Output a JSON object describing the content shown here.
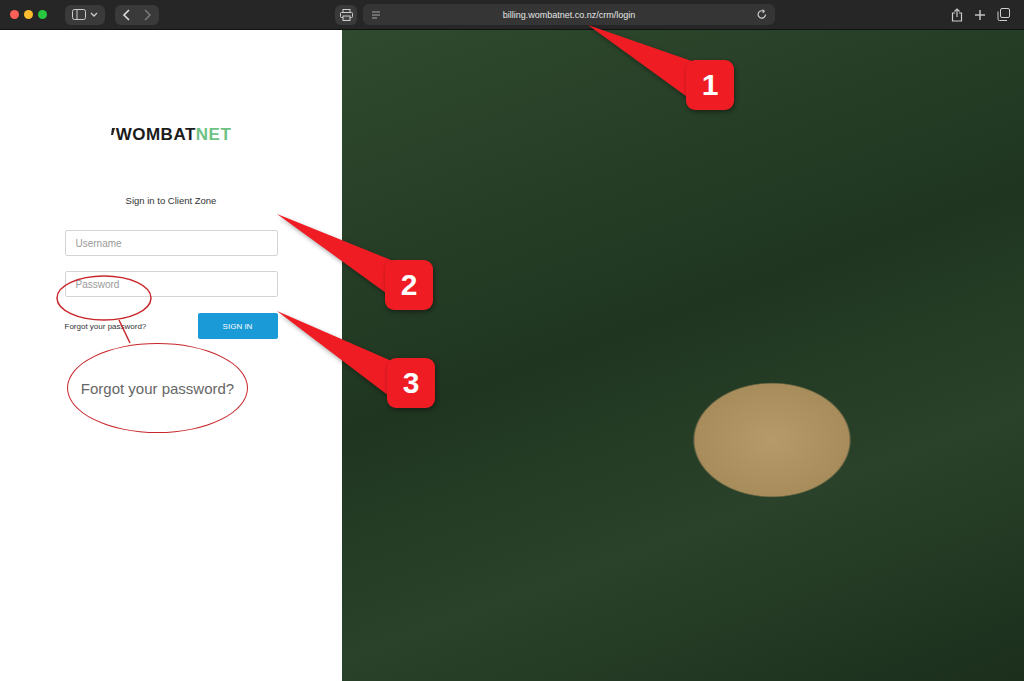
{
  "browser": {
    "url": "billing.wombatnet.co.nz/crm/login"
  },
  "login": {
    "logo": {
      "main": "WOMBAT",
      "accent": "NET"
    },
    "heading": "Sign in to Client Zone",
    "fields": [
      {
        "placeholder": "Username"
      },
      {
        "placeholder": "Password"
      }
    ],
    "forgot_link": "Forgot your password?",
    "button": "SIGN IN"
  },
  "annotations": {
    "badges": [
      {
        "label": "1"
      },
      {
        "label": "2"
      },
      {
        "label": "3"
      }
    ],
    "zoom": {
      "text": "Forgot your password?"
    }
  }
}
